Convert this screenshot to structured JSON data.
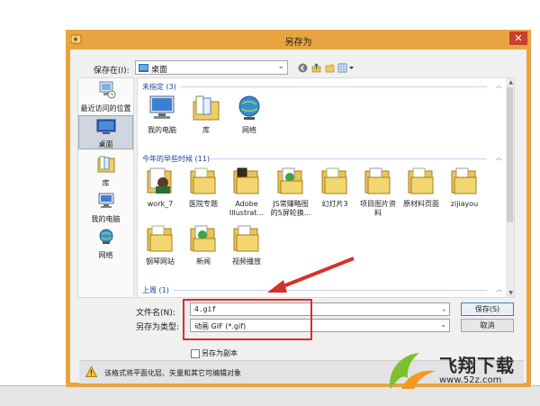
{
  "window": {
    "title": "另存为"
  },
  "toolbar": {
    "save_in_label": "保存在(I):",
    "save_in_value": "桌面"
  },
  "places": [
    {
      "label": "最近访问的位置",
      "icon": "recent-places-icon"
    },
    {
      "label": "桌面",
      "icon": "desktop-icon",
      "active": true
    },
    {
      "label": "库",
      "icon": "libraries-icon"
    },
    {
      "label": "我的电脑",
      "icon": "computer-icon"
    },
    {
      "label": "网络",
      "icon": "network-icon"
    }
  ],
  "groups": [
    {
      "header": "未指定 (3)",
      "items": [
        {
          "label": "我的电脑",
          "icon": "computer-icon"
        },
        {
          "label": "库",
          "icon": "libraries-icon"
        },
        {
          "label": "网络",
          "icon": "network-icon"
        }
      ]
    },
    {
      "header": "今年的早些时候 (11)",
      "items": [
        {
          "label": "work_7",
          "icon": "folder-icon"
        },
        {
          "label": "医院专题",
          "icon": "folder-icon"
        },
        {
          "label": "Adobe Illustrat...",
          "icon": "folder-icon"
        },
        {
          "label": "JS常赚略图的5屏轮换...",
          "icon": "folder-icon"
        },
        {
          "label": "幻灯片3",
          "icon": "folder-icon"
        },
        {
          "label": "项目图片资料",
          "icon": "folder-icon"
        },
        {
          "label": "原材料页面",
          "icon": "folder-icon"
        },
        {
          "label": "zijiayou",
          "icon": "folder-icon"
        },
        {
          "label": "钢琴网站",
          "icon": "folder-icon"
        },
        {
          "label": "新闻",
          "icon": "folder-icon"
        },
        {
          "label": "视频播放",
          "icon": "folder-icon"
        }
      ]
    },
    {
      "header": "上周 (1)",
      "items": []
    }
  ],
  "form": {
    "filename_label": "文件名(N):",
    "filename_value": "4.gif",
    "filetype_label": "另存为类型:",
    "filetype_value": "动画 GIF (*.gif)",
    "save_copy_label": "另存为副本",
    "save_button": "保存(S)",
    "cancel_button": "取消"
  },
  "warning": {
    "text": "该格式将平面化层、矢量和其它可编辑对象"
  },
  "watermark": {
    "title": "飞翔下载",
    "url": "www.52z.com"
  },
  "colors": {
    "titlebar": "#e8a440",
    "close": "#c7412f",
    "highlight": "#d6302a",
    "group_header": "#1f3f9e"
  }
}
